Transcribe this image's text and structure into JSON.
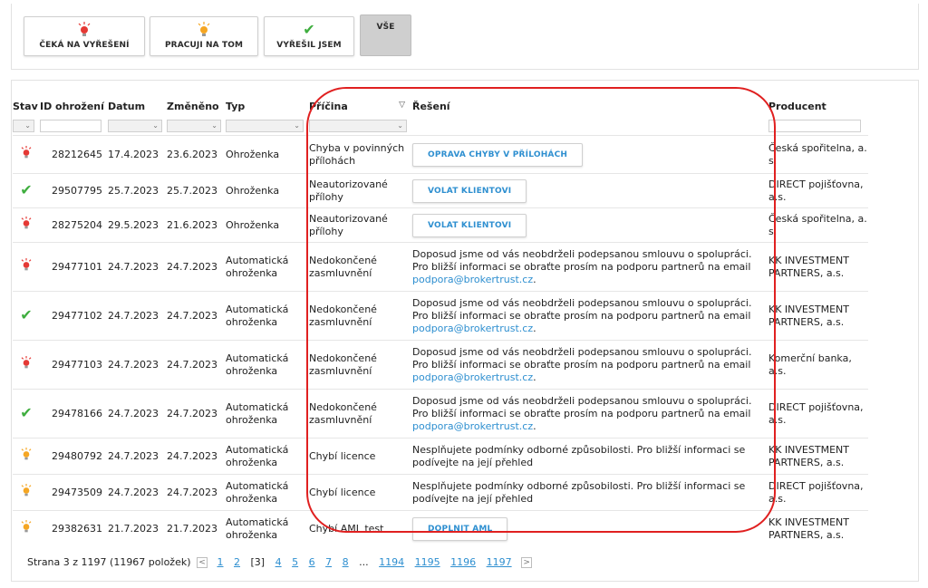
{
  "filters": [
    {
      "label": "ČEKÁ NA VYŘEŠENÍ",
      "icon": "red-bulb-icon"
    },
    {
      "label": "PRACUJI NA TOM",
      "icon": "yellow-bulb-icon"
    },
    {
      "label": "VYŘEŠIL JSEM",
      "icon": "green-check-icon"
    },
    {
      "label": "VŠE",
      "icon": ""
    }
  ],
  "columns": {
    "stav": "Stav",
    "id": "ID ohrožení",
    "datum": "Datum",
    "zmeneno": "Změněno",
    "typ": "Typ",
    "pricina": "Příčina",
    "reseni": "Řešení",
    "producent": "Producent"
  },
  "rows": [
    {
      "status": "red",
      "id": "28212645",
      "datum": "17.4.2023",
      "zmeneno": "23.6.2023",
      "typ": "Ohroženka",
      "pricina": "Chyba v povinných přílohách",
      "action": "OPRAVA CHYBY V PŘÍLOHÁCH",
      "producent": "Česká spořitelna, a. s."
    },
    {
      "status": "green",
      "id": "29507795",
      "datum": "25.7.2023",
      "zmeneno": "25.7.2023",
      "typ": "Ohroženka",
      "pricina": "Neautorizované přílohy",
      "action": "VOLAT KLIENTOVI",
      "producent": "DIRECT pojišťovna, a.s."
    },
    {
      "status": "red",
      "id": "28275204",
      "datum": "29.5.2023",
      "zmeneno": "21.6.2023",
      "typ": "Ohroženka",
      "pricina": "Neautorizované přílohy",
      "action": "VOLAT KLIENTOVI",
      "producent": "Česká spořitelna, a. s."
    },
    {
      "status": "red",
      "id": "29477101",
      "datum": "24.7.2023",
      "zmeneno": "24.7.2023",
      "typ": "Automatická ohroženka",
      "pricina": "Nedokončené zasmluvnění",
      "text": "Doposud jsme od vás neobdrželi podepsanou smlouvu o spolupráci. Pro bližší informaci se obraťte prosím na podporu partnerů na email",
      "email": "podpora@brokertrust.cz",
      "producent": "KK INVESTMENT PARTNERS, a.s."
    },
    {
      "status": "green",
      "id": "29477102",
      "datum": "24.7.2023",
      "zmeneno": "24.7.2023",
      "typ": "Automatická ohroženka",
      "pricina": "Nedokončené zasmluvnění",
      "text": "Doposud jsme od vás neobdrželi podepsanou smlouvu o spolupráci. Pro bližší informaci se obraťte prosím na podporu partnerů na email",
      "email": "podpora@brokertrust.cz",
      "producent": "KK INVESTMENT PARTNERS, a.s."
    },
    {
      "status": "red",
      "id": "29477103",
      "datum": "24.7.2023",
      "zmeneno": "24.7.2023",
      "typ": "Automatická ohroženka",
      "pricina": "Nedokončené zasmluvnění",
      "text": "Doposud jsme od vás neobdrželi podepsanou smlouvu o spolupráci. Pro bližší informaci se obraťte prosím na podporu partnerů na email",
      "email": "podpora@brokertrust.cz",
      "producent": "Komerční banka, a.s."
    },
    {
      "status": "green",
      "id": "29478166",
      "datum": "24.7.2023",
      "zmeneno": "24.7.2023",
      "typ": "Automatická ohroženka",
      "pricina": "Nedokončené zasmluvnění",
      "text": "Doposud jsme od vás neobdrželi podepsanou smlouvu o spolupráci. Pro bližší informaci se obraťte prosím na podporu partnerů na email",
      "email": "podpora@brokertrust.cz",
      "producent": "DIRECT pojišťovna, a.s."
    },
    {
      "status": "yellow",
      "id": "29480792",
      "datum": "24.7.2023",
      "zmeneno": "24.7.2023",
      "typ": "Automatická ohroženka",
      "pricina": "Chybí licence",
      "text": "Nesplňujete podmínky odborné způsobilosti. Pro bližší informaci se podívejte na její přehled",
      "producent": "KK INVESTMENT PARTNERS, a.s."
    },
    {
      "status": "yellow",
      "id": "29473509",
      "datum": "24.7.2023",
      "zmeneno": "24.7.2023",
      "typ": "Automatická ohroženka",
      "pricina": "Chybí licence",
      "text": "Nesplňujete podmínky odborné způsobilosti. Pro bližší informaci se podívejte na její přehled",
      "producent": "DIRECT pojišťovna, a.s."
    },
    {
      "status": "yellow",
      "id": "29382631",
      "datum": "21.7.2023",
      "zmeneno": "21.7.2023",
      "typ": "Automatická ohroženka",
      "pricina": "Chybí AML test",
      "action": "DOPLNIT AML",
      "producent": "KK INVESTMENT PARTNERS, a.s."
    }
  ],
  "pager": {
    "summary": "Strana 3 z 1197 (11967 položek)",
    "prev_icon": "chevron-left-icon",
    "next_icon": "chevron-right-icon",
    "pages_before": [
      "1",
      "2"
    ],
    "current": "[3]",
    "pages_after": [
      "4",
      "5",
      "6",
      "7",
      "8"
    ],
    "ellipsis": "...",
    "pages_end": [
      "1194",
      "1195",
      "1196",
      "1197"
    ]
  },
  "colors": {
    "accent": "#2e8fd0",
    "highlight": "#e02020",
    "green": "#3fae3f",
    "red": "#e53935",
    "yellow": "#f5a623"
  }
}
